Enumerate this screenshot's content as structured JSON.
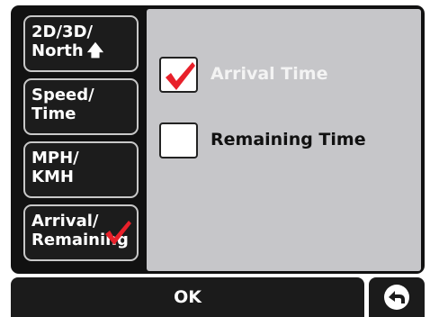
{
  "sidebar": {
    "items": [
      {
        "line1": "2D/3D/",
        "line2": "North"
      },
      {
        "line1": "Speed/",
        "line2": "Time"
      },
      {
        "line1": "MPH/",
        "line2": "KMH"
      },
      {
        "line1": "Arrival/",
        "line2": "Remaining"
      }
    ],
    "active_index": 3
  },
  "options": [
    {
      "label": "Arrival Time",
      "checked": true
    },
    {
      "label": "Remaining Time",
      "checked": false
    }
  ],
  "footer": {
    "ok_label": "OK",
    "back_icon": "back-arrow-icon"
  },
  "colors": {
    "checkmark": "#e8202a",
    "panel": "#c6c6c9",
    "button": "#1c1c1c"
  }
}
